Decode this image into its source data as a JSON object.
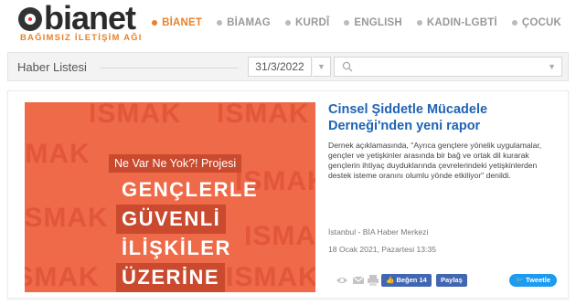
{
  "brand": {
    "name": "bianet",
    "tagline": "BAĞIMSIZ İLETİŞİM AĞI",
    "accent_color": "#e8812b"
  },
  "nav": {
    "items": [
      {
        "label": "BİANET",
        "active": true
      },
      {
        "label": "BİAMAG",
        "active": false
      },
      {
        "label": "KURDÎ",
        "active": false
      },
      {
        "label": "ENGLISH",
        "active": false
      },
      {
        "label": "KADIN-LGBTİ",
        "active": false
      },
      {
        "label": "ÇOCUK",
        "active": false
      }
    ]
  },
  "list": {
    "title": "Haber Listesi",
    "date_value": "31/3/2022",
    "search_placeholder": "",
    "search_icon": "search-icon"
  },
  "article": {
    "image": {
      "project_label": "Ne Var Ne Yok?! Projesi",
      "lines": [
        "GENÇLERLE",
        "GÜVENLİ",
        "İLİŞKİLER",
        "ÜZERİNE"
      ],
      "bg_word": "ISMAK",
      "bg_color": "#ee6a48",
      "band_color": "#c94a2e"
    },
    "title": "Cinsel Şiddetle Mücadele Derneği'nden yeni rapor",
    "summary": "Dernek açıklamasında, \"Ayrıca gençlere yönelik uygulamalar, gençler ve yetişkinler arasında bir bağ ve ortak dil kurarak gençlerin ihtiyaç duyduklarında çevrelerindeki yetişkinlerden destek isteme oranını olumlu yönde etkiliyor\" denildi.",
    "location": "İstanbul - BİA Haber Merkezi",
    "date": "18 Ocak 2021, Pazartesi 13:35",
    "actions": {
      "like_label": "Beğen 14",
      "share_label": "Paylaş",
      "tweet_label": "Tweetle"
    }
  }
}
